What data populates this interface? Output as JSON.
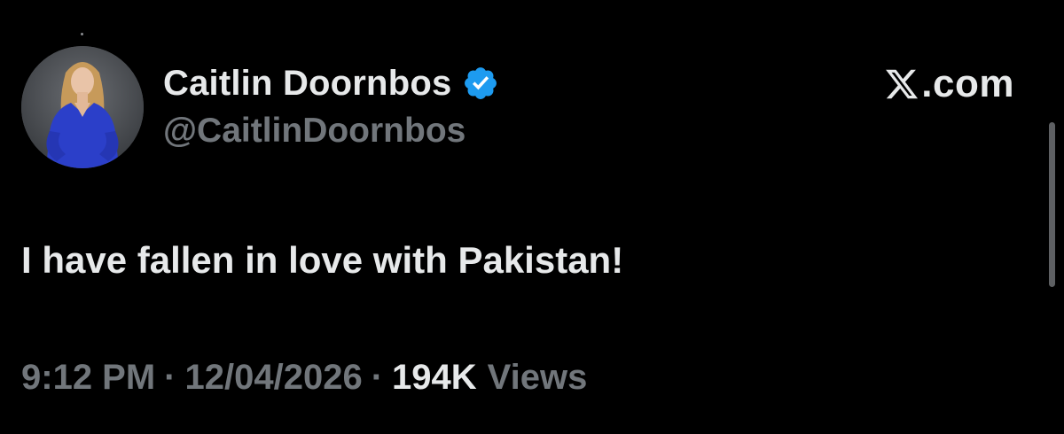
{
  "user": {
    "display_name": "Caitlin Doornbos",
    "handle": "@CaitlinDoornbos",
    "verified": true,
    "avatar_icon": "profile-photo"
  },
  "brand": {
    "logo_icon": "x-logo-icon",
    "text": ".com"
  },
  "tweet": {
    "text": "I have fallen in love with Pakistan!"
  },
  "meta": {
    "time": "9:12 PM",
    "separator": "·",
    "date": "12/04/2026",
    "views_count": "194K",
    "views_label": "Views"
  },
  "colors": {
    "background": "#000000",
    "primary_text": "#e7e9ea",
    "secondary_text": "#71767b",
    "verified_blue": "#1d9bf0"
  }
}
